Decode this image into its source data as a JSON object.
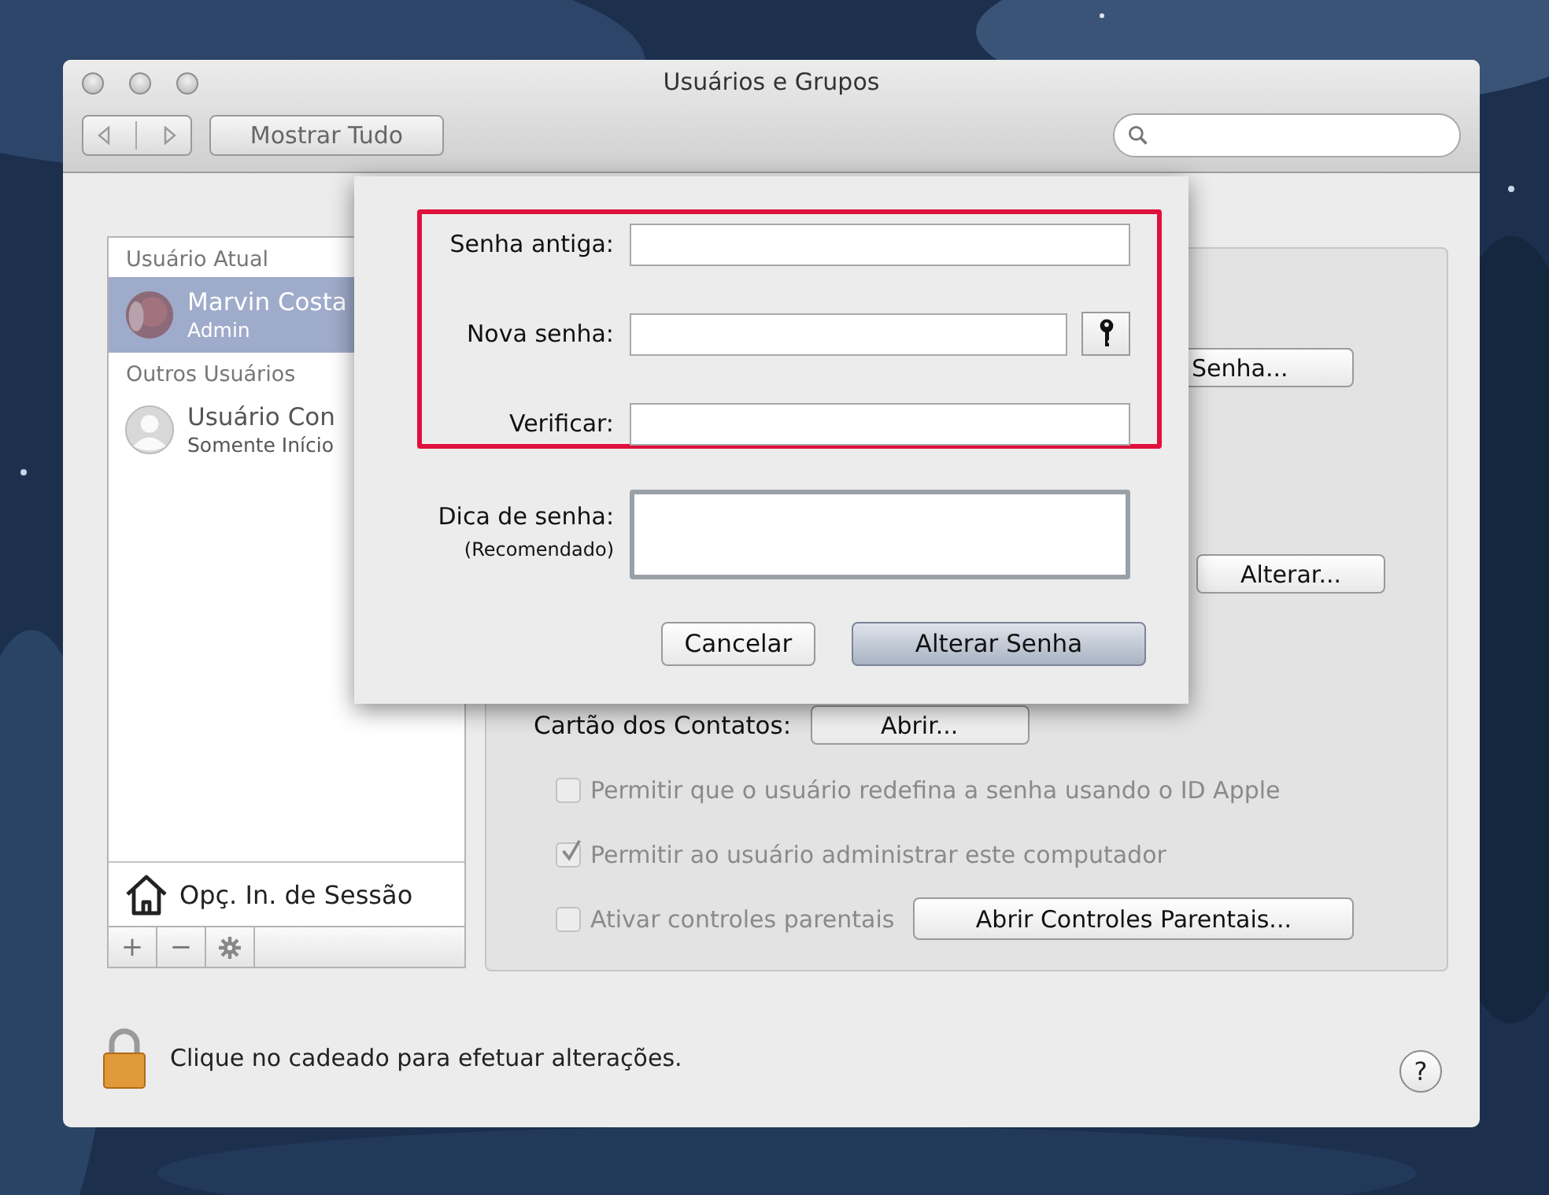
{
  "window": {
    "title": "Usuários e Grupos"
  },
  "toolbar": {
    "show_all": "Mostrar Tudo"
  },
  "sidebar": {
    "sections": [
      {
        "header": "Usuário Atual",
        "users": [
          {
            "name": "Marvin Costa",
            "role": "Admin",
            "selected": true
          }
        ]
      },
      {
        "header": "Outros Usuários",
        "users": [
          {
            "name": "Usuário Con",
            "role": "Somente Início",
            "selected": false,
            "kind": "silhouette"
          }
        ]
      }
    ],
    "login_options": "Opç. In. de Sessão",
    "buttons": [
      "+",
      "−"
    ]
  },
  "account": {
    "password_button": "Senha...",
    "edit_button": "Alterar...",
    "contacts_label": "Cartão dos Contatos:",
    "contacts_button": "Abrir...",
    "options": [
      {
        "label": "Permitir que o usuário redefina a senha usando o ID Apple",
        "checked": false,
        "disabled": true
      },
      {
        "label": "Permitir ao usuário administrar este computador",
        "checked": true,
        "disabled": true
      },
      {
        "label": "Ativar controles parentais",
        "checked": false,
        "disabled": true,
        "button": "Abrir Controles Parentais..."
      }
    ]
  },
  "sheet": {
    "fields": [
      {
        "label": "Senha antiga:",
        "kind": "text"
      },
      {
        "label": "Nova senha:",
        "kind": "key"
      },
      {
        "label": "Verificar:",
        "kind": "text"
      }
    ],
    "hint": {
      "label": "Dica de senha:",
      "note": "(Recomendado)"
    },
    "buttons": [
      {
        "label": "Cancelar",
        "default": false
      },
      {
        "label": "Alterar Senha",
        "default": true
      }
    ]
  },
  "footer": {
    "lock_text": "Clique no cadeado para efetuar alterações.",
    "help": "?"
  }
}
